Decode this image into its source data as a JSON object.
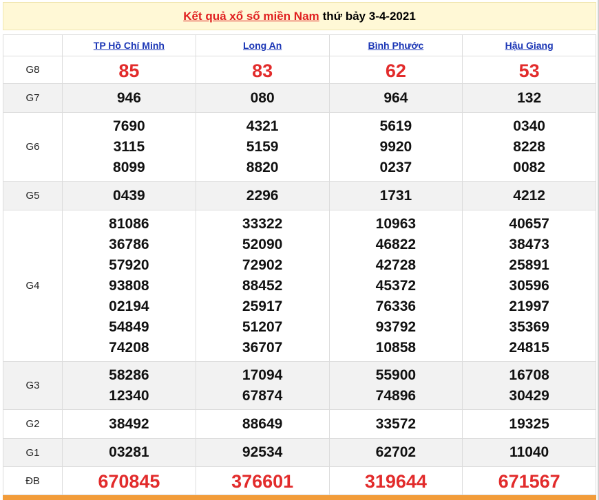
{
  "header": {
    "link_text": "Kết quả xổ số miền Nam",
    "date_text": "thứ bảy 3-4-2021"
  },
  "provinces": [
    "TP Hồ Chí Minh",
    "Long An",
    "Bình Phước",
    "Hậu Giang"
  ],
  "prizes": [
    {
      "label": "G8",
      "values": [
        [
          "85"
        ],
        [
          "83"
        ],
        [
          "62"
        ],
        [
          "53"
        ]
      ]
    },
    {
      "label": "G7",
      "values": [
        [
          "946"
        ],
        [
          "080"
        ],
        [
          "964"
        ],
        [
          "132"
        ]
      ]
    },
    {
      "label": "G6",
      "values": [
        [
          "7690",
          "3115",
          "8099"
        ],
        [
          "4321",
          "5159",
          "8820"
        ],
        [
          "5619",
          "9920",
          "0237"
        ],
        [
          "0340",
          "8228",
          "0082"
        ]
      ]
    },
    {
      "label": "G5",
      "values": [
        [
          "0439"
        ],
        [
          "2296"
        ],
        [
          "1731"
        ],
        [
          "4212"
        ]
      ]
    },
    {
      "label": "G4",
      "values": [
        [
          "81086",
          "36786",
          "57920",
          "93808",
          "02194",
          "54849",
          "74208"
        ],
        [
          "33322",
          "52090",
          "72902",
          "88452",
          "25917",
          "51207",
          "36707"
        ],
        [
          "10963",
          "46822",
          "42728",
          "45372",
          "76336",
          "93792",
          "10858"
        ],
        [
          "40657",
          "38473",
          "25891",
          "30596",
          "21997",
          "35369",
          "24815"
        ]
      ]
    },
    {
      "label": "G3",
      "values": [
        [
          "58286",
          "12340"
        ],
        [
          "17094",
          "67874"
        ],
        [
          "55900",
          "74896"
        ],
        [
          "16708",
          "30429"
        ]
      ]
    },
    {
      "label": "G2",
      "values": [
        [
          "38492"
        ],
        [
          "88649"
        ],
        [
          "33572"
        ],
        [
          "19325"
        ]
      ]
    },
    {
      "label": "G1",
      "values": [
        [
          "03281"
        ],
        [
          "92534"
        ],
        [
          "62702"
        ],
        [
          "11040"
        ]
      ]
    },
    {
      "label": "ĐB",
      "values": [
        [
          "670845"
        ],
        [
          "376601"
        ],
        [
          "319644"
        ],
        [
          "671567"
        ]
      ]
    }
  ],
  "colors": {
    "accent_red": "#e22b2b",
    "link_blue": "#1a35b5",
    "title_bg": "#fff8d6",
    "bottom_bar": "#f29c3a"
  }
}
